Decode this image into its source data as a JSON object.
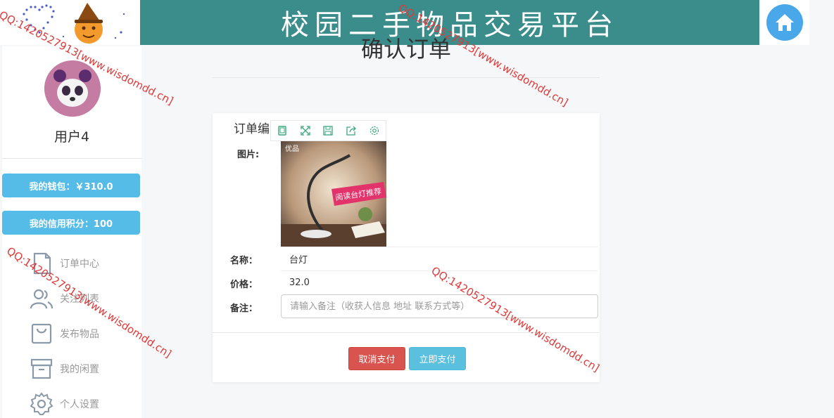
{
  "header": {
    "site_title": "校园二手物品交易平台",
    "home_icon": "home-icon"
  },
  "sidebar": {
    "username": "用户4",
    "wallet_label": "我的钱包：￥310.0",
    "credit_label": "我的信用积分：100",
    "nav_items": [
      {
        "label": "订单中心",
        "icon": "file-icon"
      },
      {
        "label": "关注列表",
        "icon": "users-icon"
      },
      {
        "label": "发布物品",
        "icon": "bag-icon"
      },
      {
        "label": "我的闲置",
        "icon": "archive-icon"
      },
      {
        "label": "个人设置",
        "icon": "gear-icon"
      }
    ]
  },
  "main": {
    "page_title": "确认订单",
    "order_label": "订单编",
    "image_label": "图片:",
    "image_badge": "优品",
    "image_banner": "阅读台灯推荐",
    "name_label": "名称：",
    "name_value": "台灯",
    "price_label": "价格：",
    "price_value": "32.0",
    "remark_label": "备注：",
    "remark_placeholder": "请输入备注（收获人信息 地址 联系方式等）",
    "cancel_button": "取消支付",
    "pay_button": "立即支付"
  },
  "watermarks": {
    "text1": "QQ:1420527913[www.wisdomdd.cn]",
    "text2": "QQ:1420527913[www.wisdomdd.cn]",
    "text3": "QQ:1420527913[www.wisdomdd.cn]",
    "text4": "QQ:1420527913[www.wisdomdd.cn]"
  },
  "colors": {
    "banner": "#3a8d8a",
    "side_button": "#55bce7",
    "cancel": "#d9534f",
    "pay": "#5bc0de"
  }
}
